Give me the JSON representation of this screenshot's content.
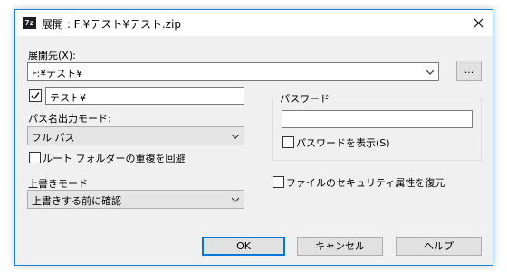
{
  "window": {
    "title": "展開 : F:¥テスト¥テスト.zip",
    "icon_text": "7z"
  },
  "destination": {
    "label": "展開先(X):",
    "value": "F:¥テスト¥",
    "browse_label": "..."
  },
  "subfolder": {
    "checked": true,
    "value": "テスト¥"
  },
  "path_mode": {
    "label": "パス名出力モード:",
    "value": "フル パス"
  },
  "root_folder_option": {
    "label": "ルート フォルダーの重複を回避",
    "checked": false
  },
  "overwrite": {
    "label": "上書きモード",
    "value": "上書きする前に確認"
  },
  "password": {
    "group_label": "パスワード",
    "value": "",
    "show_label": "パスワードを表示(S)",
    "show_checked": false
  },
  "security_option": {
    "label": "ファイルのセキュリティ属性を復元",
    "checked": false
  },
  "buttons": {
    "ok": "OK",
    "cancel": "キャンセル",
    "help": "ヘルプ"
  },
  "colors": {
    "accent": "#0078d7",
    "window_border": "#1883d7",
    "panel": "#f0f0f0"
  }
}
